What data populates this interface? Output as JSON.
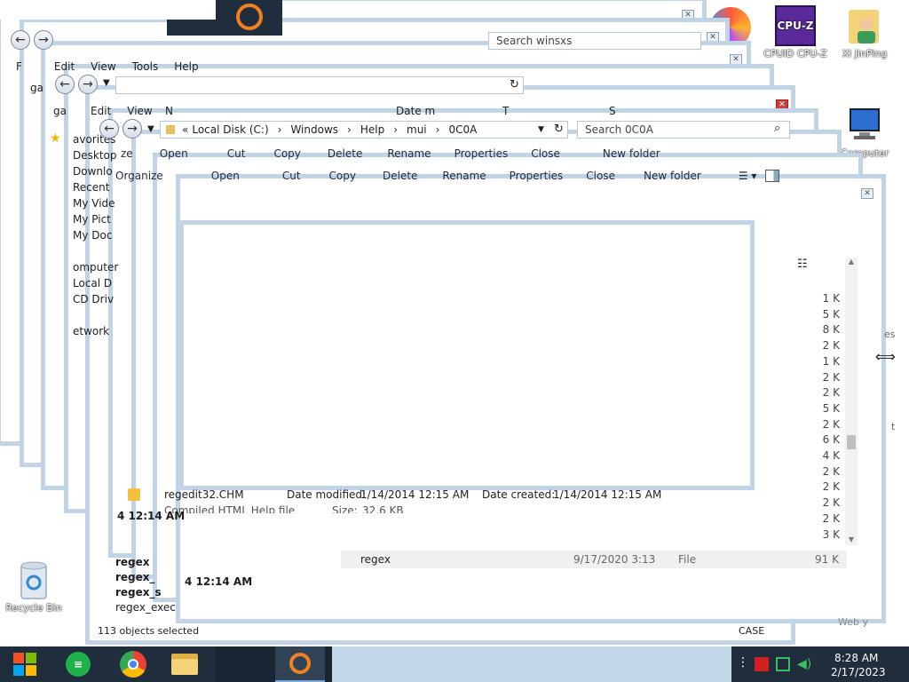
{
  "desktop": {
    "icons": [
      {
        "label": "CPUID CPU-Z",
        "icon": "cpuz-icon"
      },
      {
        "label": "Xi JinPing",
        "icon": "user-folder-icon"
      },
      {
        "label": "Computer",
        "icon": "computer-icon"
      },
      {
        "label": "Recycle Bin",
        "icon": "recycle-bin-icon"
      }
    ]
  },
  "window_back": {
    "search_placeholder": "Search winsxs",
    "menu": [
      "Edit",
      "View",
      "Tools",
      "Help"
    ],
    "menu_first": "F"
  },
  "window_mid": {
    "menu": [
      "Edit",
      "View"
    ],
    "menu_prefix": "ga",
    "column_name": "N",
    "column_date": "Date m",
    "column_type": "T",
    "column_size": "S",
    "nav_items": [
      "avorites",
      "Desktop",
      "Downlo",
      "Recent",
      "My Vide",
      "My Pict",
      "My Doc",
      "omputer",
      "Local D",
      "CD Driv",
      "etwork"
    ]
  },
  "window_front": {
    "breadcrumb": [
      "«",
      "Local Disk (C:)",
      "Windows",
      "Help",
      "mui",
      "0C0A"
    ],
    "search_placeholder": "Search 0C0A",
    "toolbar": {
      "organize": "Organize",
      "open": "Open",
      "cut": "Cut",
      "copy": "Copy",
      "delete": "Delete",
      "rename": "Rename",
      "properties": "Properties",
      "close": "Close",
      "new_folder": "New folder"
    },
    "toolbar_prefix": "ze",
    "details": {
      "name": "regedit32.CHM",
      "date_modified_label": "Date modified:",
      "date_modified": "1/14/2014 12:15 AM",
      "date_created_label": "Date created:",
      "date_created": "1/14/2014 12:15 AM",
      "type": "Compiled HTML Help file",
      "size_label": "Size:",
      "size": "32.6 KB"
    },
    "time_fragment_1": "4 12:14 AM",
    "time_fragment_2": "4 12:14 AM",
    "files": [
      "regex",
      "regex",
      "regex_",
      "regex_s",
      "regex_exec"
    ],
    "list_row": {
      "name": "regex",
      "date": "9/17/2020 3:13",
      "type": "File",
      "size": "91 K"
    },
    "sizes": [
      "1 K",
      "5 K",
      "8 K",
      "2 K",
      "1 K",
      "2 K",
      "2 K",
      "5 K",
      "2 K",
      "6 K",
      "4 K",
      "2 K",
      "2 K",
      "2 K",
      "2 K",
      "3 K"
    ],
    "status_left": "113 objects selected",
    "status_right": "CASE"
  },
  "edge_labels": {
    "computer_fragment": "es",
    "t_fragment": "t",
    "web_fragment": "Web y"
  },
  "taskbar": {
    "apps": [
      {
        "name": "start-button"
      },
      {
        "name": "notes-app"
      },
      {
        "name": "chrome-app"
      },
      {
        "name": "file-explorer-app"
      },
      {
        "name": "search-app"
      }
    ],
    "time": "8:28 AM",
    "date": "2/17/2023"
  },
  "colors": {
    "taskbar": "#1f2d3d",
    "window_frame": "#c0d4e6",
    "accent": "#1e6fd9"
  }
}
